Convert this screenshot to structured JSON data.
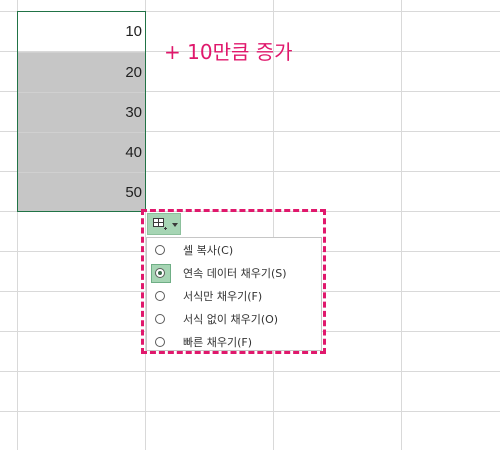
{
  "cells": [
    "10",
    "20",
    "30",
    "40",
    "50"
  ],
  "annotation": "+ 10만큼 증가",
  "autofill_menu": {
    "items": [
      {
        "label": "셀 복사(C)",
        "selected": false
      },
      {
        "label": "연속 데이터 채우기(S)",
        "selected": true
      },
      {
        "label": "서식만 채우기(F)",
        "selected": false
      },
      {
        "label": "서식 없이 채우기(O)",
        "selected": false
      },
      {
        "label": "빠른 채우기(F)",
        "selected": false
      }
    ]
  },
  "colors": {
    "annotation": "#e0186c",
    "selection_border": "#217346",
    "selection_fill": "#c6c6c6",
    "button_fill": "#a6d5b4"
  }
}
